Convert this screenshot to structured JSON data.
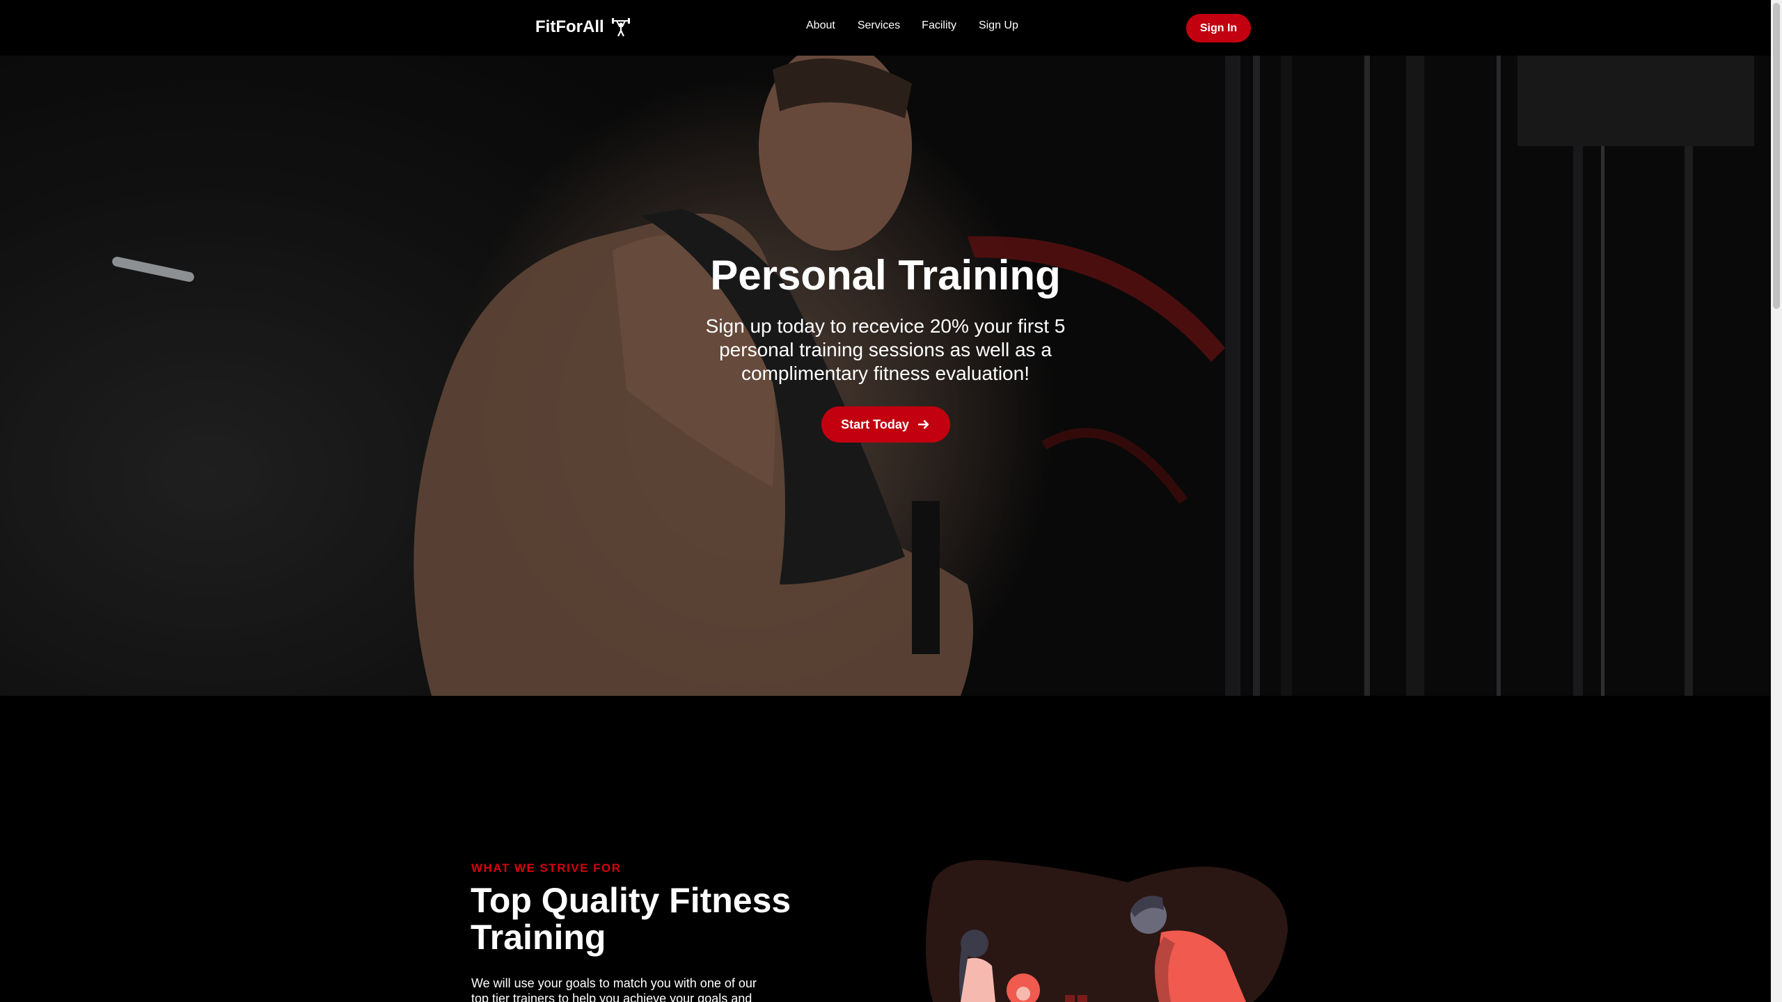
{
  "nav": {
    "logo": "FitForAll",
    "links": [
      "About",
      "Services",
      "Facility",
      "Sign Up"
    ],
    "signin_label": "Sign In",
    "logo_icon": "weightlifter-icon"
  },
  "hero": {
    "title": "Personal Training",
    "subtitle": "Sign up today to recevice 20% your first 5 personal training sessions as well as a complimentary fitness evaluation!",
    "cta_label": "Start Today",
    "cta_icon": "arrow-right-icon"
  },
  "section2": {
    "eyebrow": "WHAT WE STRIVE FOR",
    "title": "Top Quality Fitness Training",
    "body": "We will use your goals to match you with one of our top tier trainers to help you achieve your goals and"
  },
  "colors": {
    "accent": "#c3000f",
    "eyebrow": "#d7000f",
    "background": "#000000",
    "illustration_blob": "#2a1613",
    "illustration_figure": "#f05a4f"
  }
}
